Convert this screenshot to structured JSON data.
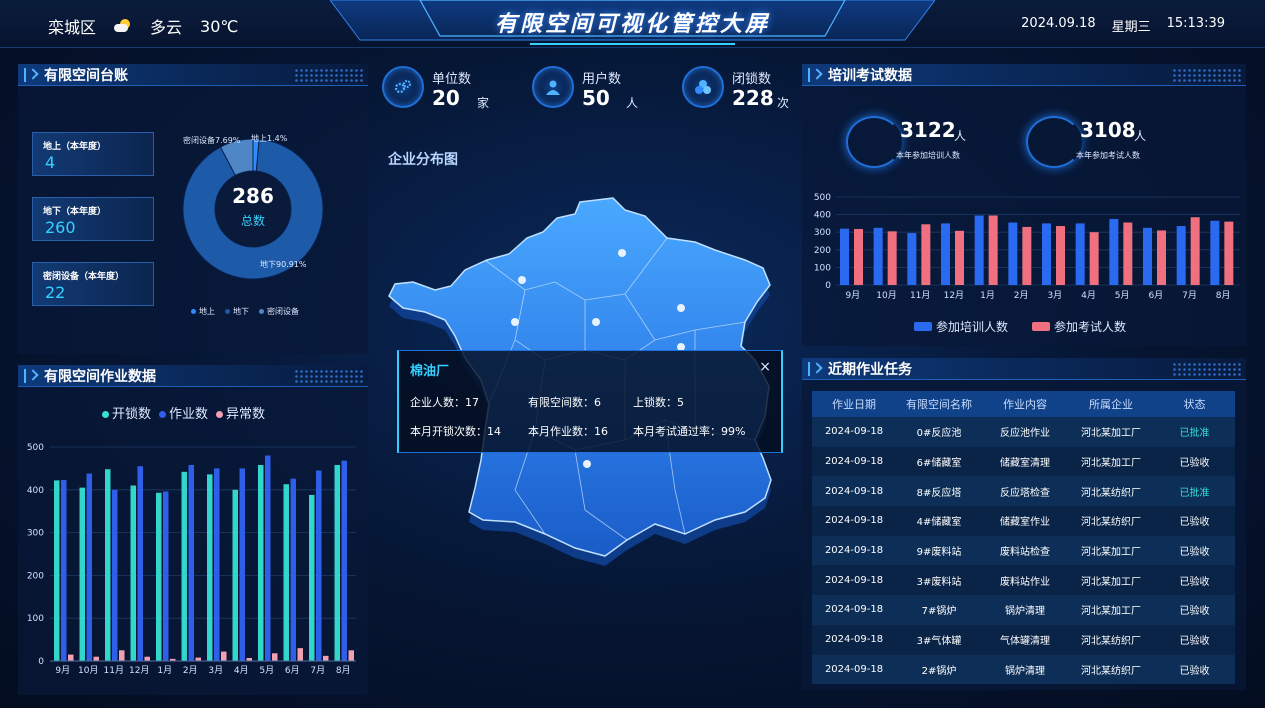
{
  "header": {
    "district": "栾城区",
    "weather_icon": "partly-cloudy-icon",
    "weather": "多云",
    "temperature": "30℃",
    "title": "有限空间可视化管控大屏",
    "date": "2024.09.18",
    "weekday": "星期三",
    "time": "15:13:39"
  },
  "ledger": {
    "title": "有限空间台账",
    "stats": [
      {
        "label": "地上（本年度）",
        "value": "4"
      },
      {
        "label": "地下（本年度）",
        "value": "260"
      },
      {
        "label": "密闭设备（本年度）",
        "value": "22"
      }
    ],
    "donut": {
      "total": "286",
      "total_label": "总数",
      "segments": [
        {
          "name": "地上",
          "label": "地上1.4%",
          "value": 1.4,
          "color": "#2f8cff"
        },
        {
          "name": "地下",
          "label": "地下90.91%",
          "value": 90.91,
          "color": "#1d5aa8"
        },
        {
          "name": "密闭设备",
          "label": "密闭设备7.69%",
          "value": 7.69,
          "color": "#4f86c6"
        }
      ]
    },
    "legend": [
      "地上",
      "地下",
      "密闭设备"
    ]
  },
  "work": {
    "title": "有限空间作业数据",
    "legend": [
      "开锁数",
      "作业数",
      "异常数"
    ]
  },
  "top_stats": [
    {
      "label": "单位数",
      "value": "20",
      "unit": "家",
      "icon": "gears-icon"
    },
    {
      "label": "用户数",
      "value": "50",
      "unit": "人",
      "icon": "user-icon"
    },
    {
      "label": "闭锁数",
      "value": "228",
      "unit": "次",
      "icon": "lock-group-icon"
    }
  ],
  "map": {
    "title": "企业分布图",
    "popup": {
      "title": "棉油厂",
      "close": "×",
      "rows": [
        [
          "企业人数：17",
          "有限空间数：6",
          "上锁数：5"
        ],
        [
          "本月开锁次数：14",
          "本月作业数：16",
          "本月考试通过率：99%"
        ]
      ]
    }
  },
  "training": {
    "title": "培训考试数据",
    "cards": [
      {
        "num": "3122",
        "unit": "人",
        "sub": "本年参加培训人数"
      },
      {
        "num": "3108",
        "unit": "人",
        "sub": "本年参加考试人数"
      }
    ]
  },
  "tasks": {
    "title": "近期作业任务",
    "columns": [
      "作业日期",
      "有限空间名称",
      "作业内容",
      "所属企业",
      "状态"
    ],
    "rows": [
      [
        "2024-09-18",
        "0#反应池",
        "反应池作业",
        "河北某加工厂",
        "已批准"
      ],
      [
        "2024-09-18",
        "6#储藏室",
        "储藏室清理",
        "河北某加工厂",
        "已验收"
      ],
      [
        "2024-09-18",
        "8#反应塔",
        "反应塔检查",
        "河北某纺织厂",
        "已批准"
      ],
      [
        "2024-09-18",
        "4#储藏室",
        "储藏室作业",
        "河北某纺织厂",
        "已验收"
      ],
      [
        "2024-09-18",
        "9#废料站",
        "废料站检查",
        "河北某加工厂",
        "已验收"
      ],
      [
        "2024-09-18",
        "3#废料站",
        "废料站作业",
        "河北某加工厂",
        "已验收"
      ],
      [
        "2024-09-18",
        "7#锅炉",
        "锅炉清理",
        "河北某加工厂",
        "已验收"
      ],
      [
        "2024-09-18",
        "3#气体罐",
        "气体罐清理",
        "河北某纺织厂",
        "已验收"
      ],
      [
        "2024-09-18",
        "2#锅炉",
        "锅炉清理",
        "河北某纺织厂",
        "已验收"
      ]
    ],
    "status_colors": {
      "已批准": "#35e0d4",
      "已验收": "#ffffff"
    }
  },
  "chart_data": [
    {
      "type": "pie",
      "title": "",
      "categories": [
        "地上",
        "地下",
        "密闭设备"
      ],
      "values": [
        1.4,
        90.91,
        7.69
      ]
    },
    {
      "type": "bar",
      "title": "",
      "categories": [
        "9月",
        "10月",
        "11月",
        "12月",
        "1月",
        "2月",
        "3月",
        "4月",
        "5月",
        "6月",
        "7月",
        "8月"
      ],
      "ylim": [
        0,
        500
      ],
      "yticks": [
        "0",
        "100",
        "200",
        "300",
        "400",
        "500"
      ],
      "series": [
        {
          "name": "开锁数",
          "values": [
            422,
            405,
            448,
            410,
            393,
            442,
            436,
            400,
            458,
            413,
            388,
            458
          ],
          "color": "#35e0d4"
        },
        {
          "name": "作业数",
          "values": [
            423,
            438,
            400,
            455,
            396,
            458,
            450,
            450,
            480,
            426,
            445,
            468
          ],
          "color": "#2f5fe8"
        },
        {
          "name": "异常数",
          "values": [
            15,
            10,
            25,
            10,
            5,
            8,
            22,
            7,
            18,
            30,
            12,
            25
          ],
          "color": "#f0a0b0"
        }
      ]
    },
    {
      "type": "bar",
      "title": "",
      "categories": [
        "9月",
        "10月",
        "11月",
        "12月",
        "1月",
        "2月",
        "3月",
        "4月",
        "5月",
        "6月",
        "7月",
        "8月"
      ],
      "ylim": [
        0,
        500
      ],
      "yticks": [
        "0",
        "100",
        "200",
        "300",
        "400",
        "500"
      ],
      "series": [
        {
          "name": "参加培训人数",
          "values": [
            320,
            325,
            295,
            350,
            395,
            355,
            350,
            350,
            375,
            325,
            335,
            365
          ],
          "color": "#2a6af0"
        },
        {
          "name": "参加考试人数",
          "values": [
            318,
            305,
            345,
            308,
            395,
            330,
            335,
            300,
            355,
            310,
            385,
            360
          ],
          "color": "#f07080"
        }
      ]
    }
  ]
}
